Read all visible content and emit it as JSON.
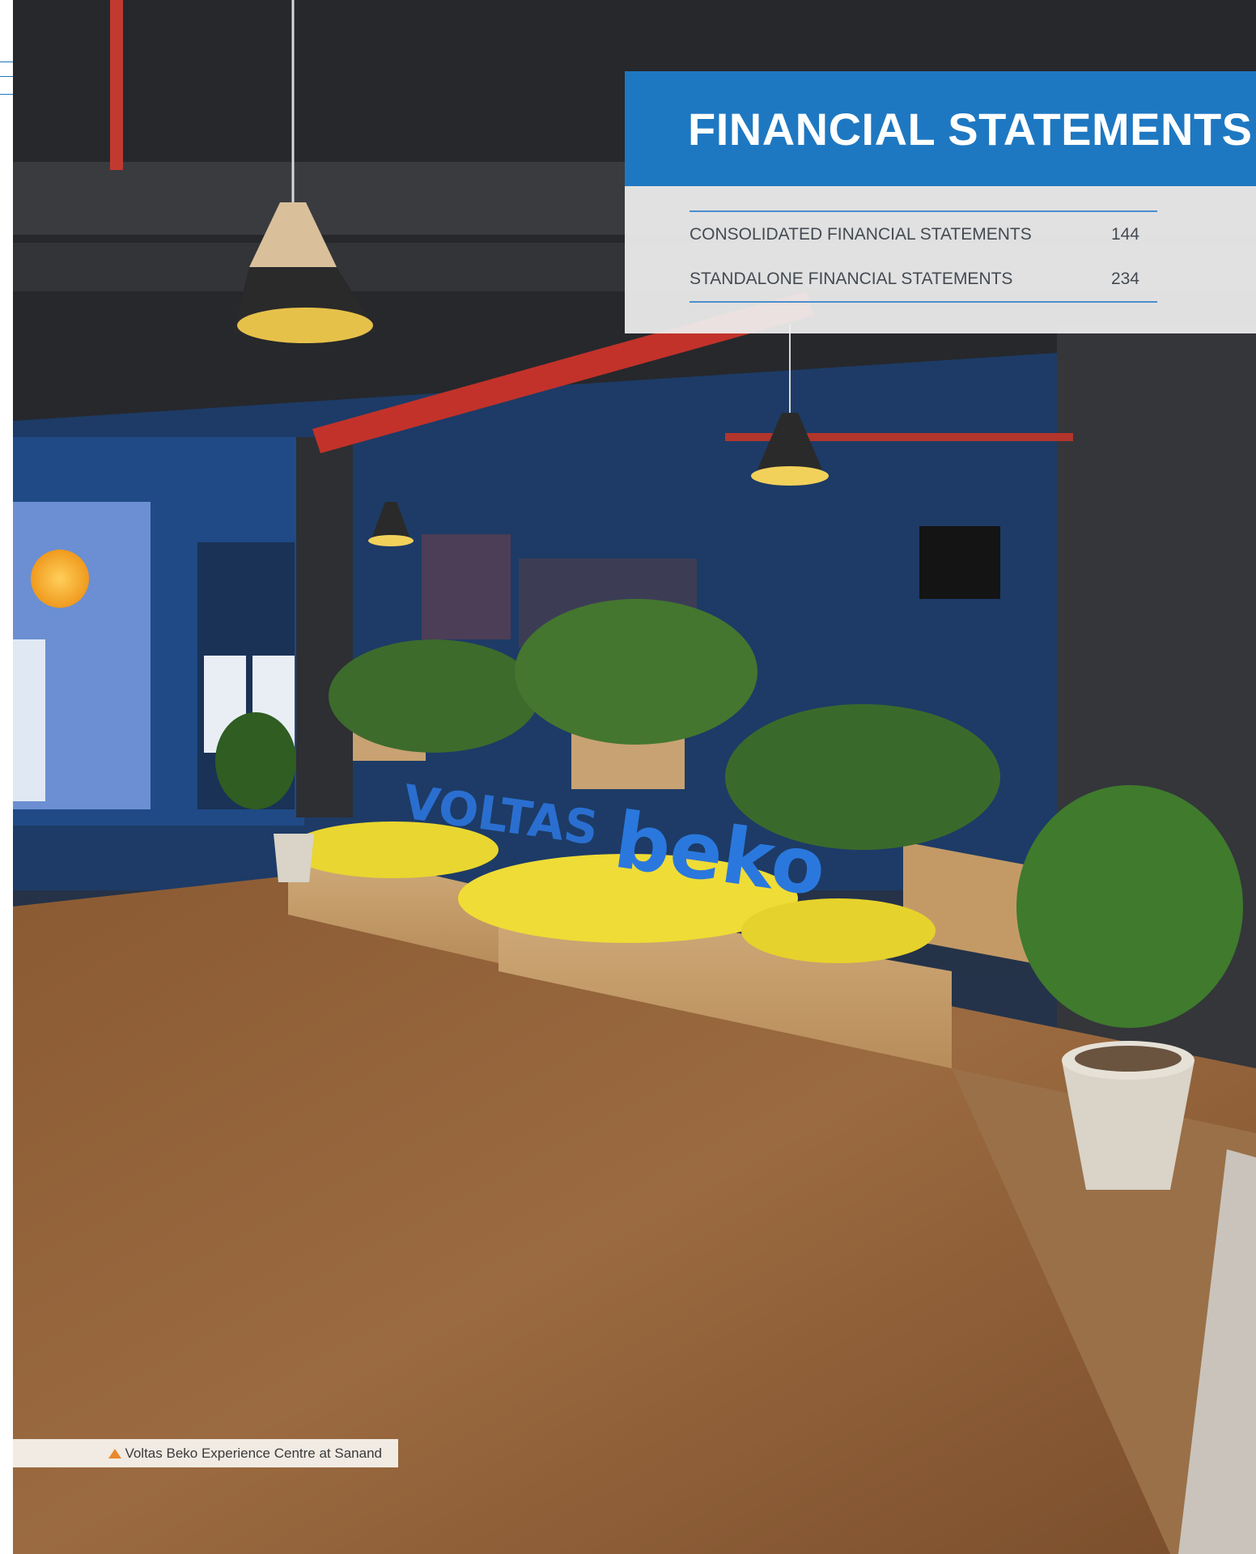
{
  "section": {
    "title": "FINANCIAL STATEMENTS"
  },
  "toc": {
    "items": [
      {
        "label": "CONSOLIDATED FINANCIAL STATEMENTS",
        "page": "144"
      },
      {
        "label": "STANDALONE FINANCIAL STATEMENTS",
        "page": "234"
      }
    ]
  },
  "photo": {
    "caption": "Voltas Beko Experience Centre at Sanand",
    "caption_icon": "triangle-up-icon",
    "signage_text": "VOLTAS · beko"
  },
  "colors": {
    "accent_blue": "#1e78c1",
    "caption_marker": "#e8892c",
    "panel_bg": "#ececec"
  }
}
